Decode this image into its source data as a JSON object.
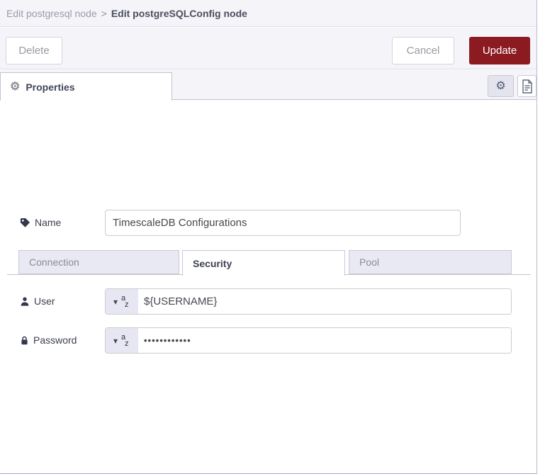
{
  "breadcrumb": {
    "parent": "Edit postgresql node",
    "separator": ">",
    "current": "Edit postgreSQLConfig node"
  },
  "toolbar": {
    "delete_label": "Delete",
    "cancel_label": "Cancel",
    "update_label": "Update"
  },
  "editor_tabs": {
    "properties_label": "Properties",
    "gear_button": "node-settings",
    "doc_button": "node-description"
  },
  "form": {
    "name_label": "Name",
    "name_value": "TimescaleDB Configurations",
    "tabs": [
      {
        "label": "Connection",
        "active": false
      },
      {
        "label": "Security",
        "active": true
      },
      {
        "label": "Pool",
        "active": false
      }
    ],
    "user_label": "User",
    "user_value": "${USERNAME}",
    "password_label": "Password",
    "password_value": "••••••••••••",
    "type_indicator": {
      "letter_a": "a",
      "letter_z": "z"
    }
  },
  "icons": {
    "caret_down": "▾",
    "gear": "⚙"
  },
  "colors": {
    "update_red": "#8c1a21",
    "panel_bg": "#f4f4f9",
    "tab_inactive_bg": "#e9e9f4"
  }
}
